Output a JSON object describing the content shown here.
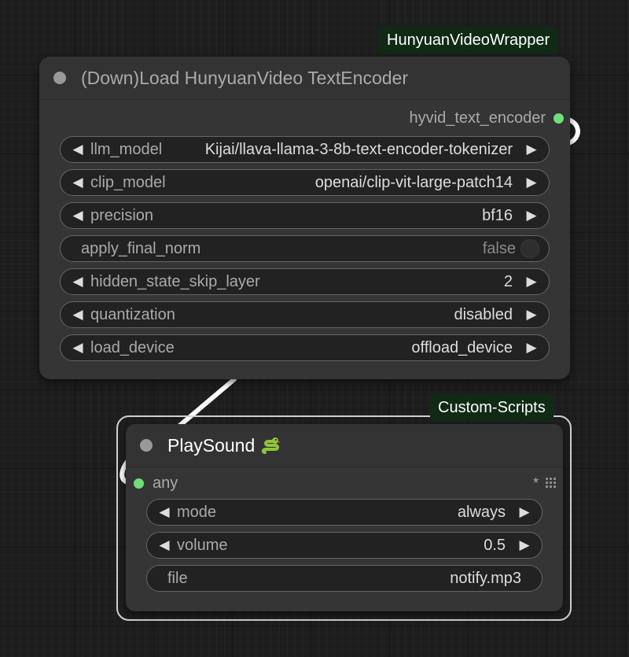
{
  "colors": {
    "canvas": "#1d1d1d",
    "node_body": "#353535",
    "widget_bg": "#222222",
    "badge_bg": "#102a16",
    "slot_connected": "#6ee07a",
    "link": "#ffffff"
  },
  "text_encoder_node": {
    "badge": "HunyuanVideoWrapper",
    "title": "(Down)Load HunyuanVideo TextEncoder",
    "output_label": "hyvid_text_encoder",
    "widgets": [
      {
        "type": "combo",
        "label": "llm_model",
        "value": "Kijai/llava-llama-3-8b-text-encoder-tokenizer"
      },
      {
        "type": "combo",
        "label": "clip_model",
        "value": "openai/clip-vit-large-patch14"
      },
      {
        "type": "combo",
        "label": "precision",
        "value": "bf16"
      },
      {
        "type": "toggle",
        "label": "apply_final_norm",
        "value": "false"
      },
      {
        "type": "number",
        "label": "hidden_state_skip_layer",
        "value": "2"
      },
      {
        "type": "combo",
        "label": "quantization",
        "value": "disabled"
      },
      {
        "type": "combo",
        "label": "load_device",
        "value": "offload_device"
      }
    ]
  },
  "playsound_node": {
    "badge": "Custom-Scripts",
    "title": "PlaySound",
    "title_icon": "snake-icon",
    "input_label": "any",
    "input_extra": "*",
    "widgets": [
      {
        "type": "combo",
        "label": "mode",
        "value": "always"
      },
      {
        "type": "number",
        "label": "volume",
        "value": "0.5"
      },
      {
        "type": "text",
        "label": "file",
        "value": "notify.mp3"
      }
    ]
  }
}
